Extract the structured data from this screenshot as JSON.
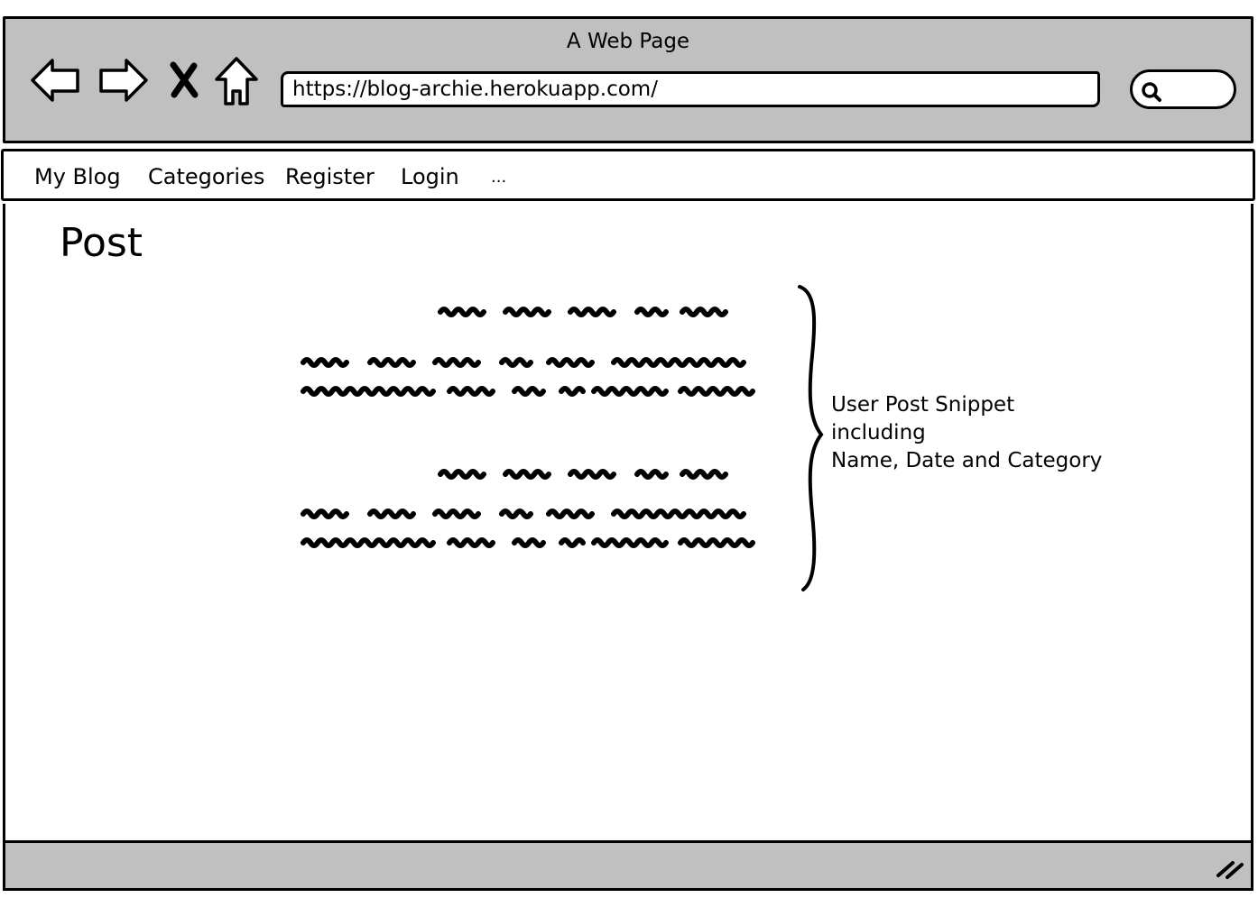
{
  "window": {
    "title": "A Web Page"
  },
  "toolbar": {
    "back_icon": "back-arrow-icon",
    "forward_icon": "forward-arrow-icon",
    "stop_icon": "stop-x-icon",
    "home_icon": "home-icon",
    "url": "https://blog-archie.herokuapp.com/",
    "search_icon": "search-icon"
  },
  "navbar": {
    "items": [
      {
        "label": "My Blog"
      },
      {
        "label": "Categories"
      },
      {
        "label": "Register"
      },
      {
        "label": "Login"
      },
      {
        "label": "..."
      }
    ]
  },
  "main": {
    "title": "Post",
    "annotation": {
      "lines": [
        "User Post Snippet",
        "including",
        "Name, Date and Category"
      ]
    }
  },
  "statusbar": {
    "grip_icon": "resize-grip-icon"
  }
}
